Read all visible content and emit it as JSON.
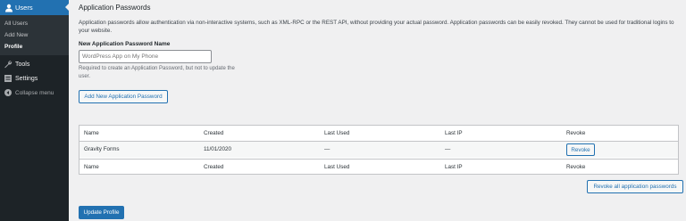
{
  "sidebar": {
    "users": {
      "label": "Users",
      "icon": "users-icon"
    },
    "submenu": [
      "All Users",
      "Add New",
      "Profile"
    ],
    "current": "Profile",
    "tools": {
      "label": "Tools",
      "icon": "wrench-icon"
    },
    "settings": {
      "label": "Settings",
      "icon": "settings-icon"
    },
    "collapse": {
      "label": "Collapse menu",
      "icon": "collapse-icon"
    }
  },
  "main": {
    "title": "Application Passwords",
    "description": "Application passwords allow authentication via non-interactive systems, such as XML-RPC or the REST API, without providing your actual password. Application passwords can be easily revoked. They cannot be used for traditional logins to your website.",
    "field_label": "New Application Password Name",
    "field_placeholder": "WordPress App on My Phone",
    "field_help": "Required to create an Application Password, but not to update the user.",
    "add_button": "Add New Application Password",
    "table": {
      "columns": [
        "Name",
        "Created",
        "Last Used",
        "Last IP",
        "Revoke"
      ],
      "rows": [
        {
          "name": "Gravity Forms",
          "created": "11/01/2020",
          "last_used": "—",
          "last_ip": "—",
          "revoke": "Revoke"
        }
      ]
    },
    "revoke_all": "Revoke all application passwords",
    "update_button": "Update Profile"
  },
  "colors": {
    "accent": "#2271b1",
    "sidebar_bg": "#1d2327",
    "submenu_bg": "#2c3338",
    "page_bg": "#f0f0f1"
  }
}
